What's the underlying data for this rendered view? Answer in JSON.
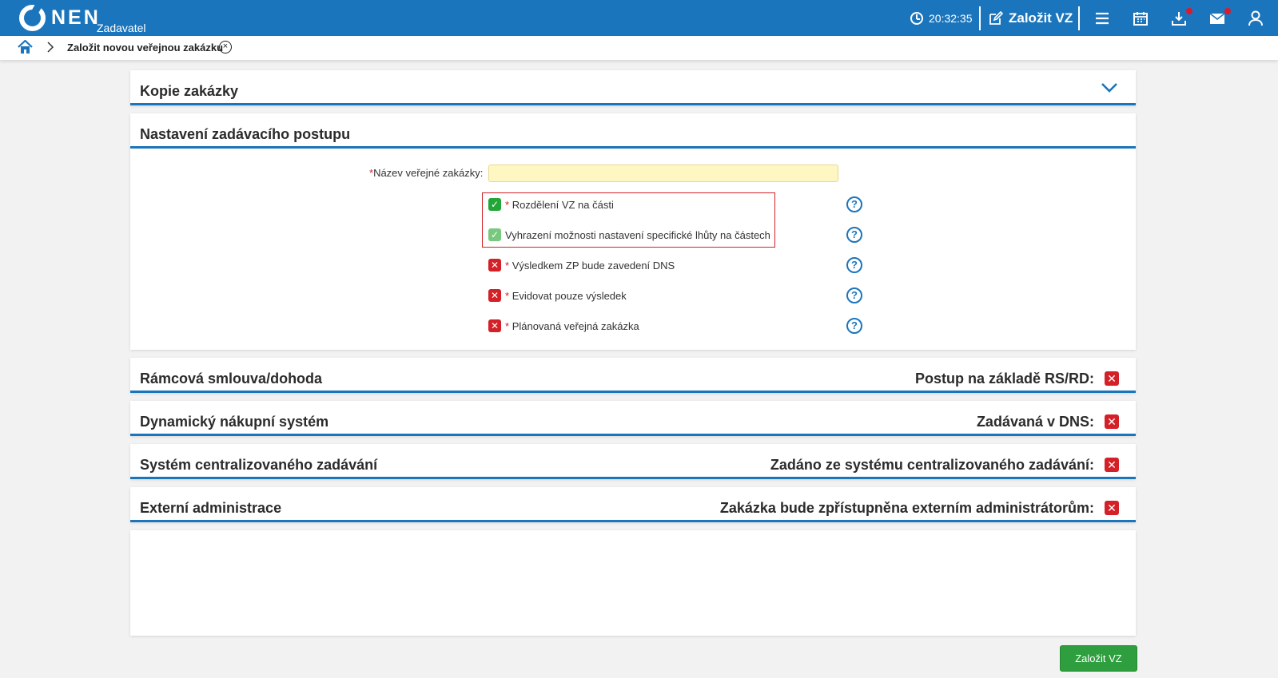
{
  "topbar": {
    "brand": "NEN",
    "role": "Zadavatel",
    "time": "20:32:35",
    "create_label": "Založit VZ"
  },
  "breadcrumb": {
    "current": "Založit novou veřejnou zakázku",
    "close_glyph": "×"
  },
  "sections": {
    "copy": {
      "title": "Kopie zakázky"
    },
    "settings": {
      "title": "Nastavení zadávacího postupu",
      "name_label": "Název veřejné zakázky:",
      "name_value": "",
      "required_mark": "*",
      "options": [
        {
          "label": "Rozdělení VZ na části",
          "required": true,
          "state": "checked"
        },
        {
          "label": "Vyhrazení možnosti nastavení specifické lhůty na částech",
          "required": false,
          "state": "checked-light"
        },
        {
          "label": "Výsledkem ZP bude zavedení DNS",
          "required": true,
          "state": "unchecked"
        },
        {
          "label": "Evidovat pouze výsledek",
          "required": true,
          "state": "unchecked"
        },
        {
          "label": "Plánovaná veřejná zakázka",
          "required": true,
          "state": "unchecked"
        }
      ],
      "help_glyph": "?"
    },
    "framework": {
      "title": "Rámcová smlouva/dohoda",
      "right_label": "Postup na základě RS/RD:"
    },
    "dns": {
      "title": "Dynamický nákupní systém",
      "right_label": "Zadávaná v DNS:"
    },
    "central": {
      "title": "Systém centralizovaného zadávání",
      "right_label": "Zadáno ze systému centralizovaného zadávání:"
    },
    "external": {
      "title": "Externí administrace",
      "right_label": "Zakázka bude zpřístupněna externím administrátorům:"
    }
  },
  "glyphs": {
    "check": "✓",
    "cross": "✕"
  },
  "submit_label": "Založit VZ",
  "colors": {
    "primary": "#1b75bc",
    "danger": "#d42027",
    "success": "#2e9e3e",
    "input_bg": "#fff7c2"
  }
}
